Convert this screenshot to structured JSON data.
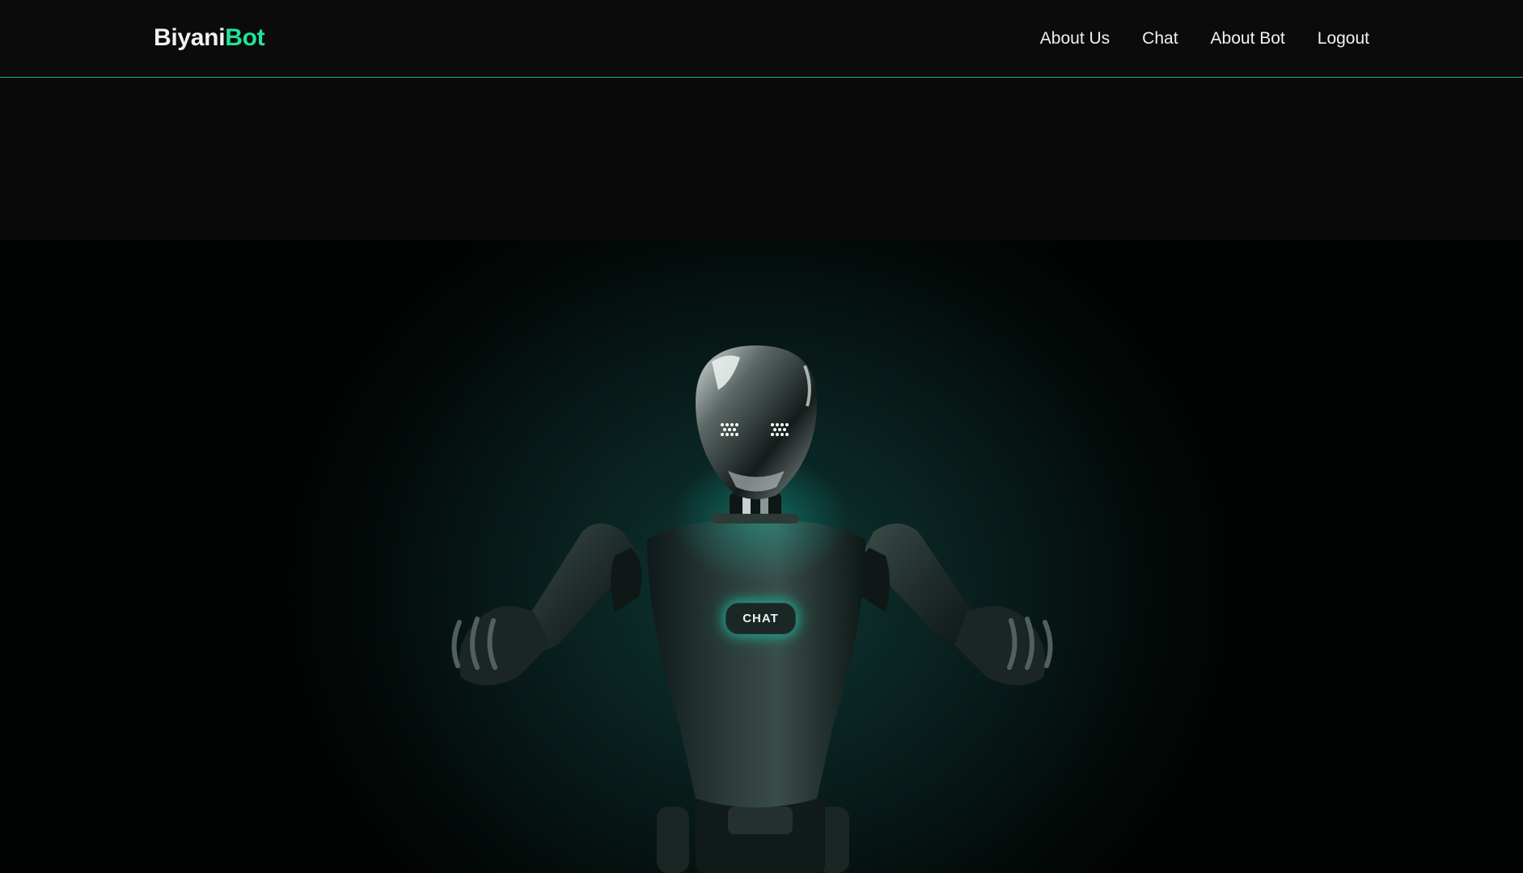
{
  "brand": {
    "part1": "Biyani",
    "part2": "Bot"
  },
  "nav": {
    "items": [
      {
        "label": "About Us"
      },
      {
        "label": "Chat"
      },
      {
        "label": "About Bot"
      },
      {
        "label": "Logout"
      }
    ]
  },
  "hero": {
    "chat_button": "CHAT"
  },
  "colors": {
    "accent": "#1fe39a",
    "nav_border": "#1fb876",
    "background": "#0a0a0a",
    "glow": "#19dcbe"
  }
}
